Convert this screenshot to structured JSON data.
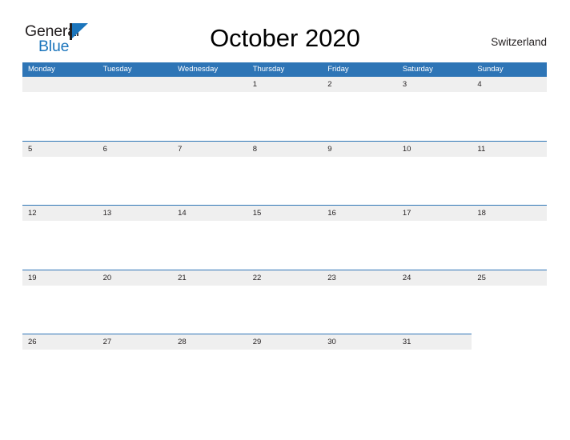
{
  "brand": {
    "name_part1": "General",
    "name_part2": "Blue",
    "flag_icon": "triangle-flag-icon",
    "accent_color": "#1b75bc"
  },
  "header": {
    "title": "October 2020",
    "locale": "Switzerland"
  },
  "calendar": {
    "month": "October",
    "year": "2020",
    "header_color": "#2E75B6",
    "band_color": "#EFEFEF",
    "weekdays": [
      "Monday",
      "Tuesday",
      "Wednesday",
      "Thursday",
      "Friday",
      "Saturday",
      "Sunday"
    ],
    "weeks": [
      {
        "partial": false,
        "days": [
          "",
          "",
          "",
          "1",
          "2",
          "3",
          "4"
        ]
      },
      {
        "partial": false,
        "days": [
          "5",
          "6",
          "7",
          "8",
          "9",
          "10",
          "11"
        ]
      },
      {
        "partial": false,
        "days": [
          "12",
          "13",
          "14",
          "15",
          "16",
          "17",
          "18"
        ]
      },
      {
        "partial": false,
        "days": [
          "19",
          "20",
          "21",
          "22",
          "23",
          "24",
          "25"
        ]
      },
      {
        "partial": true,
        "days": [
          "26",
          "27",
          "28",
          "29",
          "30",
          "31"
        ]
      }
    ]
  }
}
